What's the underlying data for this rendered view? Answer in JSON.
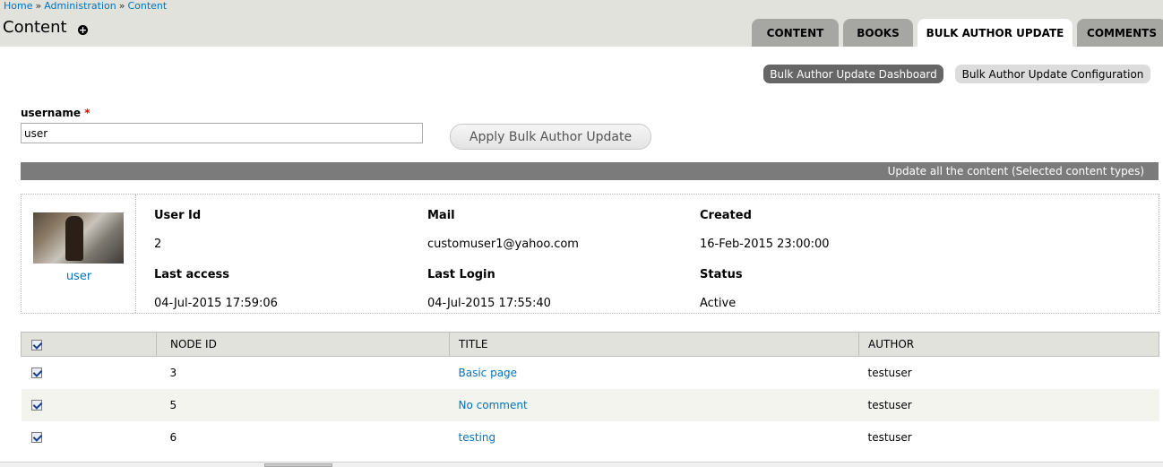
{
  "breadcrumb": [
    "Home",
    "Administration",
    "Content"
  ],
  "breadcrumb_separator": "»",
  "page_title": "Content",
  "tabs": [
    {
      "label": "CONTENT",
      "active": false
    },
    {
      "label": "BOOKS",
      "active": false
    },
    {
      "label": "BULK AUTHOR UPDATE",
      "active": true
    },
    {
      "label": "COMMENTS",
      "active": false
    }
  ],
  "local_actions": {
    "dashboard": "Bulk Author Update Dashboard",
    "configuration": "Bulk Author Update Configuration"
  },
  "form": {
    "username_label": "username",
    "required_mark": "*",
    "username_value": "user",
    "apply_button": "Apply Bulk Author Update"
  },
  "update_bar_text": "Update all the content (Selected content types)",
  "user_info": {
    "name": "user",
    "user_id_label": "User Id",
    "user_id": "2",
    "mail_label": "Mail",
    "mail": "customuser1@yahoo.com",
    "created_label": "Created",
    "created": "16-Feb-2015 23:00:00",
    "last_access_label": "Last access",
    "last_access": "04-Jul-2015 17:59:06",
    "last_login_label": "Last Login",
    "last_login": "04-Jul-2015 17:55:40",
    "status_label": "Status",
    "status": "Active"
  },
  "table": {
    "headers": [
      "NODE ID",
      "TITLE",
      "AUTHOR"
    ],
    "rows": [
      {
        "node_id": "3",
        "title": "Basic page",
        "author": "testuser"
      },
      {
        "node_id": "5",
        "title": "No comment",
        "author": "testuser"
      },
      {
        "node_id": "6",
        "title": "testing",
        "author": "testuser"
      }
    ]
  },
  "colors": {
    "link": "#0074bd",
    "header_bg": "#e1e2dc",
    "tab_inactive": "#a6a7a2",
    "update_bar": "#7b7b7b"
  }
}
